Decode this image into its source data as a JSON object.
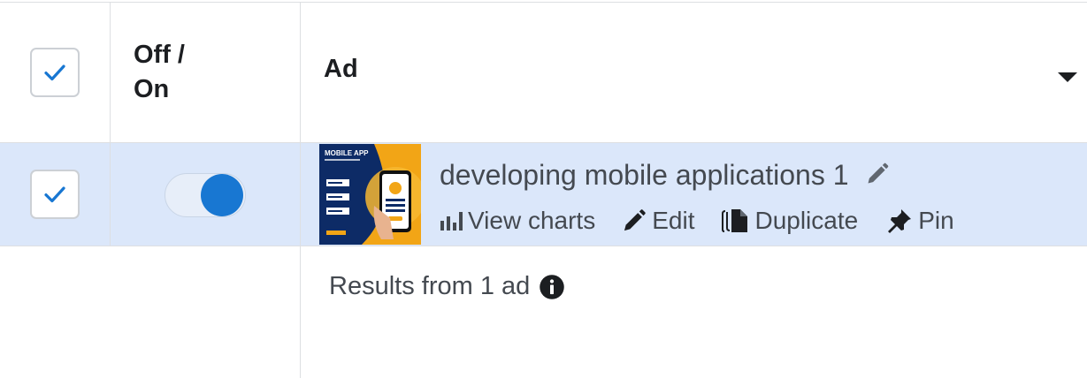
{
  "header": {
    "select_all_checked": true,
    "col_offon": "Off /",
    "col_offon_line2": "On",
    "col_ad": "Ad"
  },
  "rows": [
    {
      "checked": true,
      "toggle_on": true,
      "ad_name": "developing mobile applications 1",
      "thumbnail_title": "MOBILE APP",
      "actions": {
        "view_charts": "View charts",
        "edit": "Edit",
        "duplicate": "Duplicate",
        "pin": "Pin"
      }
    }
  ],
  "footer": {
    "results_text": "Results from 1 ad"
  },
  "colors": {
    "accent": "#1877d2",
    "selected_row_bg": "#dbe7fa",
    "border": "#dddfe2"
  },
  "icons": [
    "check-icon",
    "sort-caret-icon",
    "pencil-icon",
    "bar-chart-icon",
    "duplicate-icon",
    "pin-icon",
    "info-icon"
  ]
}
